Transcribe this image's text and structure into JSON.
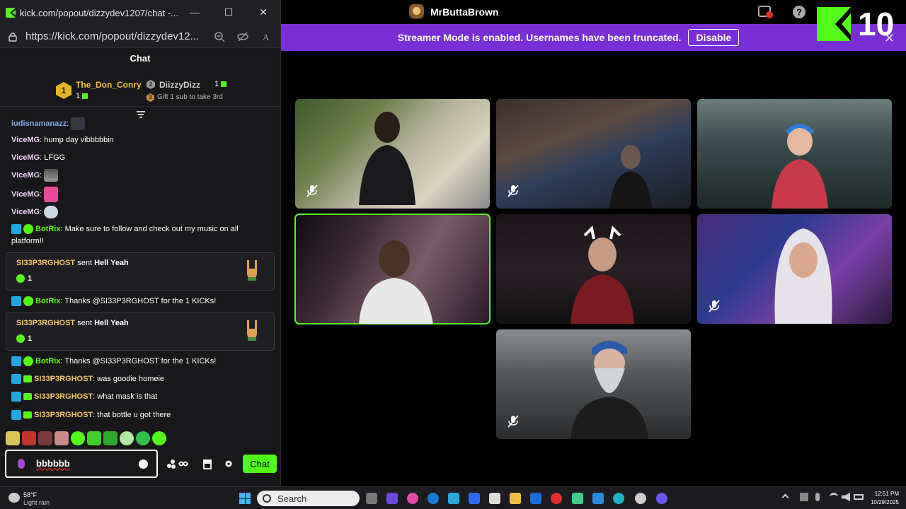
{
  "browser": {
    "title": "kick.com/popout/dizzydev1207/chat -...",
    "url": "https://kick.com/popout/dizzydev12...",
    "minimize": "—",
    "maximize": "☐",
    "close": "✕"
  },
  "chat": {
    "header": "Chat",
    "leaderboard": {
      "first": {
        "rank": "1",
        "name": "The_Don_Conry",
        "count": "1"
      },
      "second": {
        "rank": "2",
        "name": "DiizzyDizz",
        "count": "1"
      },
      "gift_hint_rank": "3",
      "gift_hint": "Gift 1 sub to take 3rd"
    },
    "messages": [
      {
        "user": "iudisnamanazz",
        "text": ""
      },
      {
        "user": "ViceMG",
        "text": "hump day vibbbbbin"
      },
      {
        "user": "ViceMG",
        "text": "LFGG"
      },
      {
        "user": "ViceMG",
        "text": ""
      },
      {
        "user": "ViceMG",
        "text": ""
      },
      {
        "user": "ViceMG",
        "text": ""
      },
      {
        "user": "BotRix",
        "text": "Make sure to follow and check out my music on all",
        "text2": "platform!!"
      },
      {
        "user": "BotRix",
        "text": "Thanks @SI33P3RGHOST for the 1 KICKs!"
      },
      {
        "user": "BotRix",
        "text": "Thanks @SI33P3RGHOST for the 1 KICKs!"
      },
      {
        "user": "SI33P3RGHOST",
        "text": "was goodie homeie"
      },
      {
        "user": "SI33P3RGHOST",
        "text": "what mask is that"
      },
      {
        "user": "SI33P3RGHOST",
        "text": "that bottle u got there"
      }
    ],
    "gifts": [
      {
        "user": "SI33P3RGHOST",
        "verb": "sent",
        "item": "Hell Yeah",
        "amount": "1"
      },
      {
        "user": "SI33P3RGHOST",
        "verb": "sent",
        "item": "Hell Yeah",
        "amount": "1"
      }
    ],
    "input_value": "bbbbbb",
    "send_label": "Chat"
  },
  "stream": {
    "streamer": "MrButtaBrown",
    "banner_text": "Streamer Mode is enabled. Usernames have been truncated.",
    "banner_button": "Disable",
    "kick_count": "10",
    "close": "✕"
  },
  "taskbar": {
    "temp": "58°F",
    "condition": "Light rain",
    "search": "Search",
    "time": "12:51 PM",
    "date": "10/29/2025"
  },
  "colors": {
    "kick_green": "#53fc18",
    "banner_purple": "#7a2fd6",
    "chat_bg": "#18181b"
  }
}
